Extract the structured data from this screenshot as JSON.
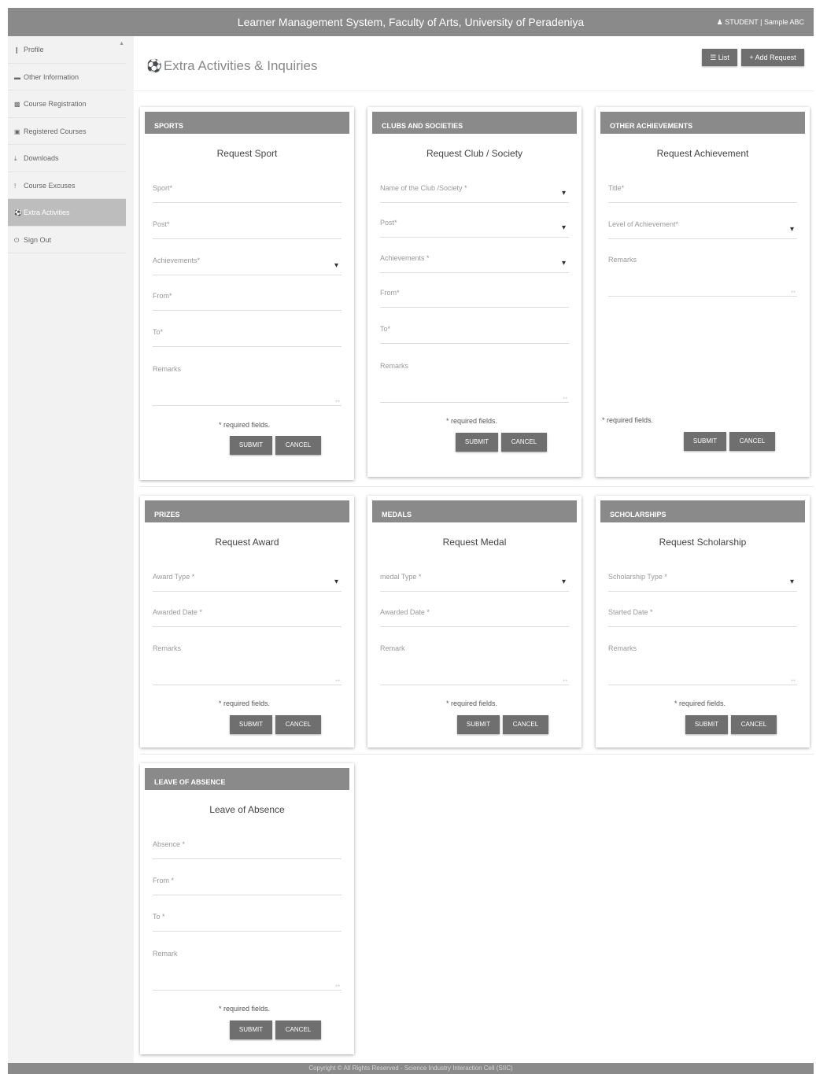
{
  "header": {
    "title": "Learner Management System, Faculty of Arts, University of Peradeniya",
    "user_role": "STUDENT",
    "user_name": "Sample ABC",
    "user_separator": "|"
  },
  "sidebar": {
    "items": [
      {
        "label": "Profile",
        "icon": "id-badge-icon"
      },
      {
        "label": "Other Information",
        "icon": "folder-icon"
      },
      {
        "label": "Course Registration",
        "icon": "book-icon"
      },
      {
        "label": "Registered Courses",
        "icon": "document-icon"
      },
      {
        "label": "Downloads",
        "icon": "download-icon"
      },
      {
        "label": "Course Excuses",
        "icon": "exclamation-icon"
      },
      {
        "label": "Extra Activities",
        "icon": "soccer-ball-icon"
      },
      {
        "label": "Sign Out",
        "icon": "power-icon"
      }
    ],
    "active": "Extra Activities"
  },
  "page": {
    "title": "Extra Activities & Inquiries",
    "list_button": "List",
    "add_button": "Add Request"
  },
  "cards": {
    "sports": {
      "heading": "SPORTS",
      "subtitle": "Request Sport",
      "fields": [
        "Sport*",
        "Post*",
        "Achievements*",
        "From*",
        "To*",
        "Remarks"
      ],
      "required_note": "* required fields.",
      "submit": "SUBMIT",
      "cancel": "CANCEL"
    },
    "clubs": {
      "heading": "CLUBS AND SOCIETIES",
      "subtitle": "Request Club / Society",
      "fields": [
        "Name of the Club /Society *",
        "Post*",
        "Achievements *",
        "From*",
        "To*",
        "Remarks"
      ],
      "required_note": "* required fields.",
      "submit": "SUBMIT",
      "cancel": "CANCEL"
    },
    "achievements": {
      "heading": "OTHER ACHIEVEMENTS",
      "subtitle": "Request Achievement",
      "fields": [
        "Title*",
        "Level of Achievement*",
        "Remarks"
      ],
      "required_note": "* required fields.",
      "submit": "SUBMIT",
      "cancel": "CANCEL"
    },
    "prizes": {
      "heading": "PRIZES",
      "subtitle": "Request Award",
      "fields": [
        "Award Type *",
        "Awarded Date *",
        "Remarks"
      ],
      "required_note": "* required fields.",
      "submit": "SUBMIT",
      "cancel": "CANCEL"
    },
    "medals": {
      "heading": "MEDALS",
      "subtitle": "Request Medal",
      "fields": [
        "medal Type *",
        "Awarded Date *",
        "Remark"
      ],
      "required_note": "* required fields.",
      "submit": "SUBMIT",
      "cancel": "CANCEL"
    },
    "scholarships": {
      "heading": "SCHOLARSHIPS",
      "subtitle": "Request Scholarship",
      "fields": [
        "Scholarship Type *",
        "Started Date *",
        "Remarks"
      ],
      "required_note": "* required fields.",
      "submit": "SUBMIT",
      "cancel": "CANCEL"
    },
    "leave": {
      "heading": "LEAVE OF ABSENCE",
      "subtitle": "Leave of Absence",
      "fields": [
        "Absence *",
        "From *",
        "To *",
        "Remark"
      ],
      "required_note": "* required fields.",
      "submit": "SUBMIT",
      "cancel": "CANCEL"
    }
  },
  "footer": {
    "text": "Copyright © All Rights Reserved - Science Industry Interaction Cell (SIIC)"
  }
}
